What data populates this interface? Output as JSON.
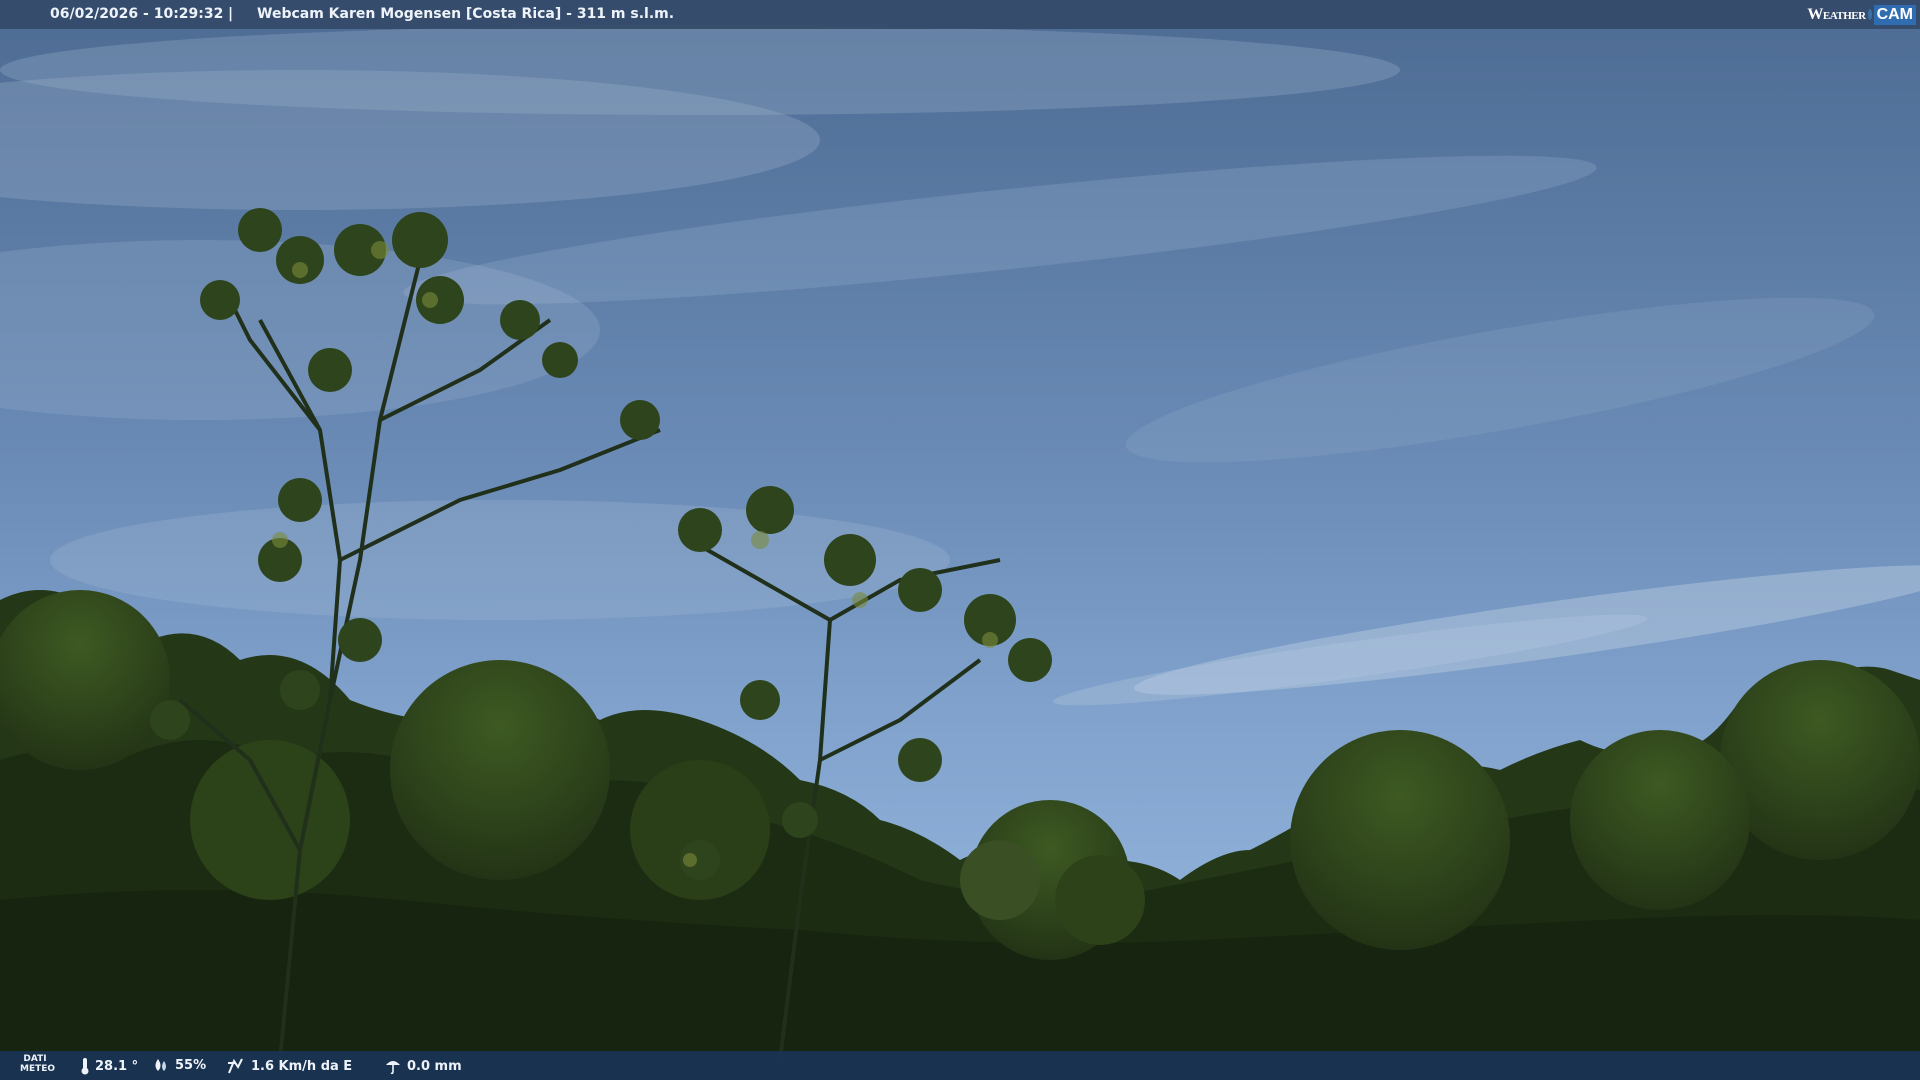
{
  "overlay": {
    "timestamp": "06/02/2026 - 10:29:32",
    "separator": "|",
    "title": "Webcam Karen Mogensen [Costa Rica]  - 311 m s.l.m.",
    "logo_weather": "Weather",
    "logo_cam": "CAM"
  },
  "weather": {
    "label_line1": "DATI",
    "label_line2": "METEO",
    "temperature": "28.1 °",
    "humidity": "55%",
    "wind": "1.6 Km/h da E",
    "rain": "0.0 mm"
  },
  "icons": {
    "temperature": "thermometer-icon",
    "humidity": "humidity-icon",
    "wind": "wind-icon",
    "rain": "rain-icon"
  },
  "colors": {
    "sky_top": "#4d6b93",
    "sky_bottom": "#8cadd6",
    "foliage": "#2a3d1c",
    "bar": "#34486a"
  }
}
